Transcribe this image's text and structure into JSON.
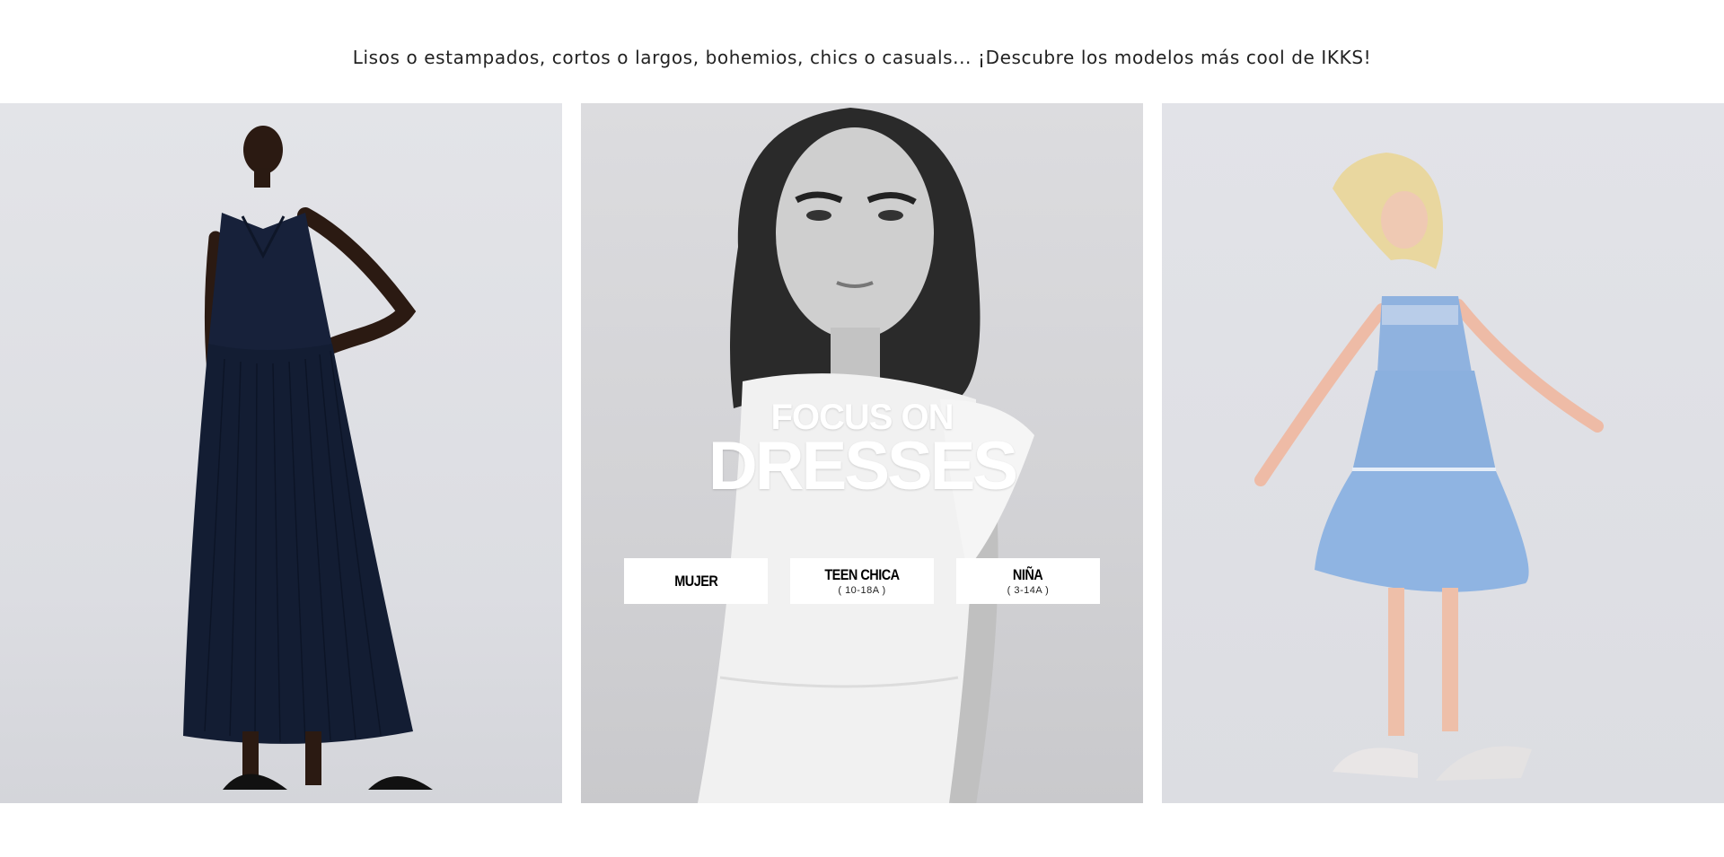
{
  "intro": {
    "text": "Lisos o estampados, cortos o largos, bohemios, chics o casuals... ¡Descubre los modelos más cool de IKKS!"
  },
  "center": {
    "headline_small": "FOCUS ON",
    "headline_big": "DRESSES",
    "buttons": [
      {
        "label": "MUJER",
        "sub": ""
      },
      {
        "label": "TEEN CHICA",
        "sub": "( 10-18A )"
      },
      {
        "label": "NIÑA",
        "sub": "( 3-14A )"
      }
    ]
  },
  "colors": {
    "text": "#222222",
    "button_bg": "#ffffff",
    "headline": "#ffffff",
    "dress_navy": "#14203a",
    "dress_blue": "#8fb2df"
  }
}
